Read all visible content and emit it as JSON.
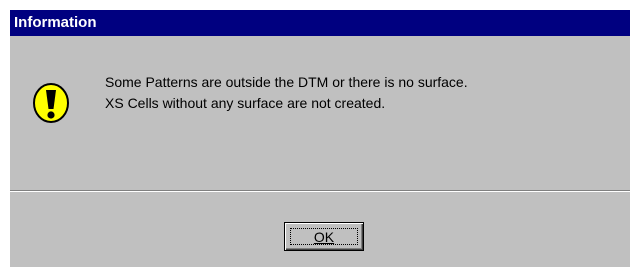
{
  "dialog": {
    "title": "Information",
    "icon": "warning-exclamation-icon",
    "message_line1": "Some Patterns are outside the DTM or there is no surface.",
    "message_line2": "XS Cells without any surface are not created.",
    "ok_label": "OK"
  },
  "colors": {
    "titlebar": "#000080",
    "face": "#c0c0c0",
    "icon_fill": "#ffff00"
  }
}
